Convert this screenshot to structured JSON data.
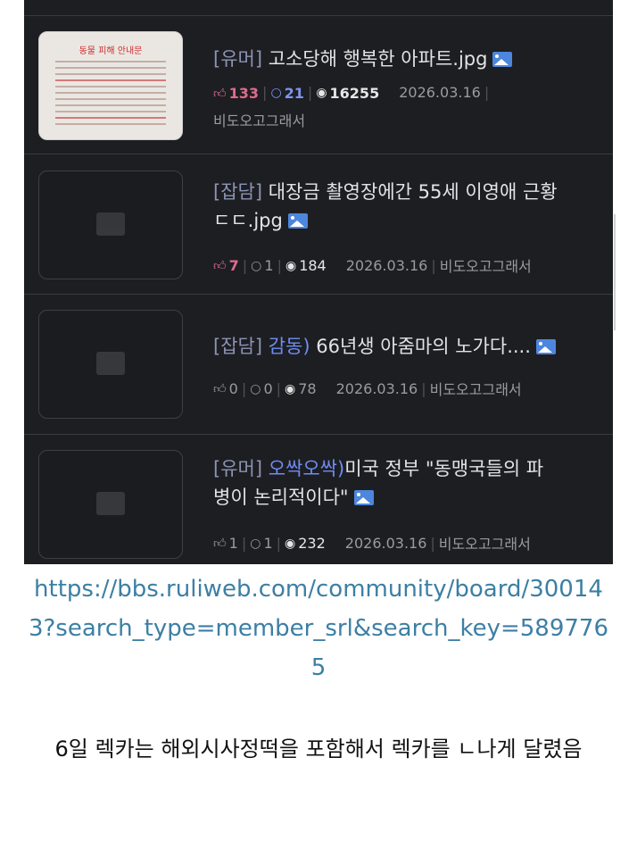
{
  "posts": [
    {
      "tag": "[유머]",
      "title": "고소당해 행복한 아파트.jpg",
      "likes": "133",
      "comments": "21",
      "views": "16255",
      "date": "2026.03.16",
      "author": "비도오고그래서",
      "thumb_text": "동물 피해 안내문"
    },
    {
      "tag": "[잡담]",
      "title": "대장금 촬영장에간 55세 이영애 근황\nㄷㄷ.jpg",
      "likes": "7",
      "comments": "1",
      "views": "184",
      "date": "2026.03.16",
      "author": "비도오고그래서"
    },
    {
      "tag": "[잡담]",
      "subtag": "감동)",
      "title": " 66년생 아줌마의 노가다....",
      "likes": "0",
      "comments": "0",
      "views": "78",
      "date": "2026.03.16",
      "author": "비도오고그래서"
    },
    {
      "tag": "[유머]",
      "subtag": "오싹오싹)",
      "title": "미국 정부 \"동맹국들의 파\n병이 논리적이다\"",
      "likes": "1",
      "comments": "1",
      "views": "232",
      "date": "2026.03.16",
      "author": "비도오고그래서"
    }
  ],
  "link_text": "https://bbs.ruliweb.com/community/board/300143?search_type=member_srl&search_key=5897765",
  "caption": "6일 렉카는 해외시사정떡을 포함해서 렉카를 ㄴ나게 달렸음",
  "colors": {
    "panel_bg": "#1d1e22",
    "link": "#3c7fa4",
    "like": "#e06b8c",
    "comment": "#7e95f0",
    "tag_highlight": "#6f8df3"
  },
  "icons": [
    "thumbs-up-icon",
    "comment-bubble-icon",
    "eye-icon",
    "image-attachment-icon",
    "image-placeholder-icon"
  ]
}
